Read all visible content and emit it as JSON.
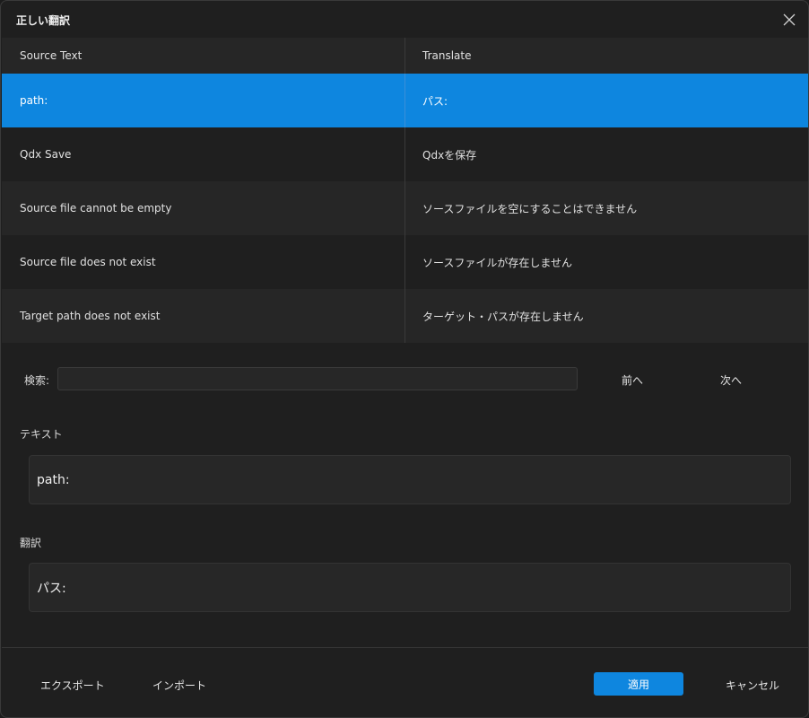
{
  "window": {
    "title": "正しい翻訳",
    "close_icon": "close-icon"
  },
  "table": {
    "headers": [
      "Source Text",
      "Translate"
    ],
    "rows": [
      {
        "source": "path:",
        "translate": "パス:",
        "selected": true
      },
      {
        "source": "Qdx Save",
        "translate": "Qdxを保存"
      },
      {
        "source": "Source file cannot be empty",
        "translate": "ソースファイルを空にすることはできません"
      },
      {
        "source": "Source file does not exist",
        "translate": "ソースファイルが存在しません"
      },
      {
        "source": "Target path does not exist",
        "translate": "ターゲット・パスが存在しません"
      }
    ]
  },
  "search": {
    "label": "検索:",
    "value": "",
    "prev": "前へ",
    "next": "次へ"
  },
  "text_section": {
    "label": "テキスト",
    "value": "path:"
  },
  "translation_section": {
    "label": "翻訳",
    "value": "パス:"
  },
  "footer": {
    "export": "エクスポート",
    "import": "インポート",
    "apply": "適用",
    "cancel": "キャンセル"
  },
  "colors": {
    "accent": "#0e86df",
    "background": "#1f1f1f",
    "row_alt": "#262626"
  }
}
